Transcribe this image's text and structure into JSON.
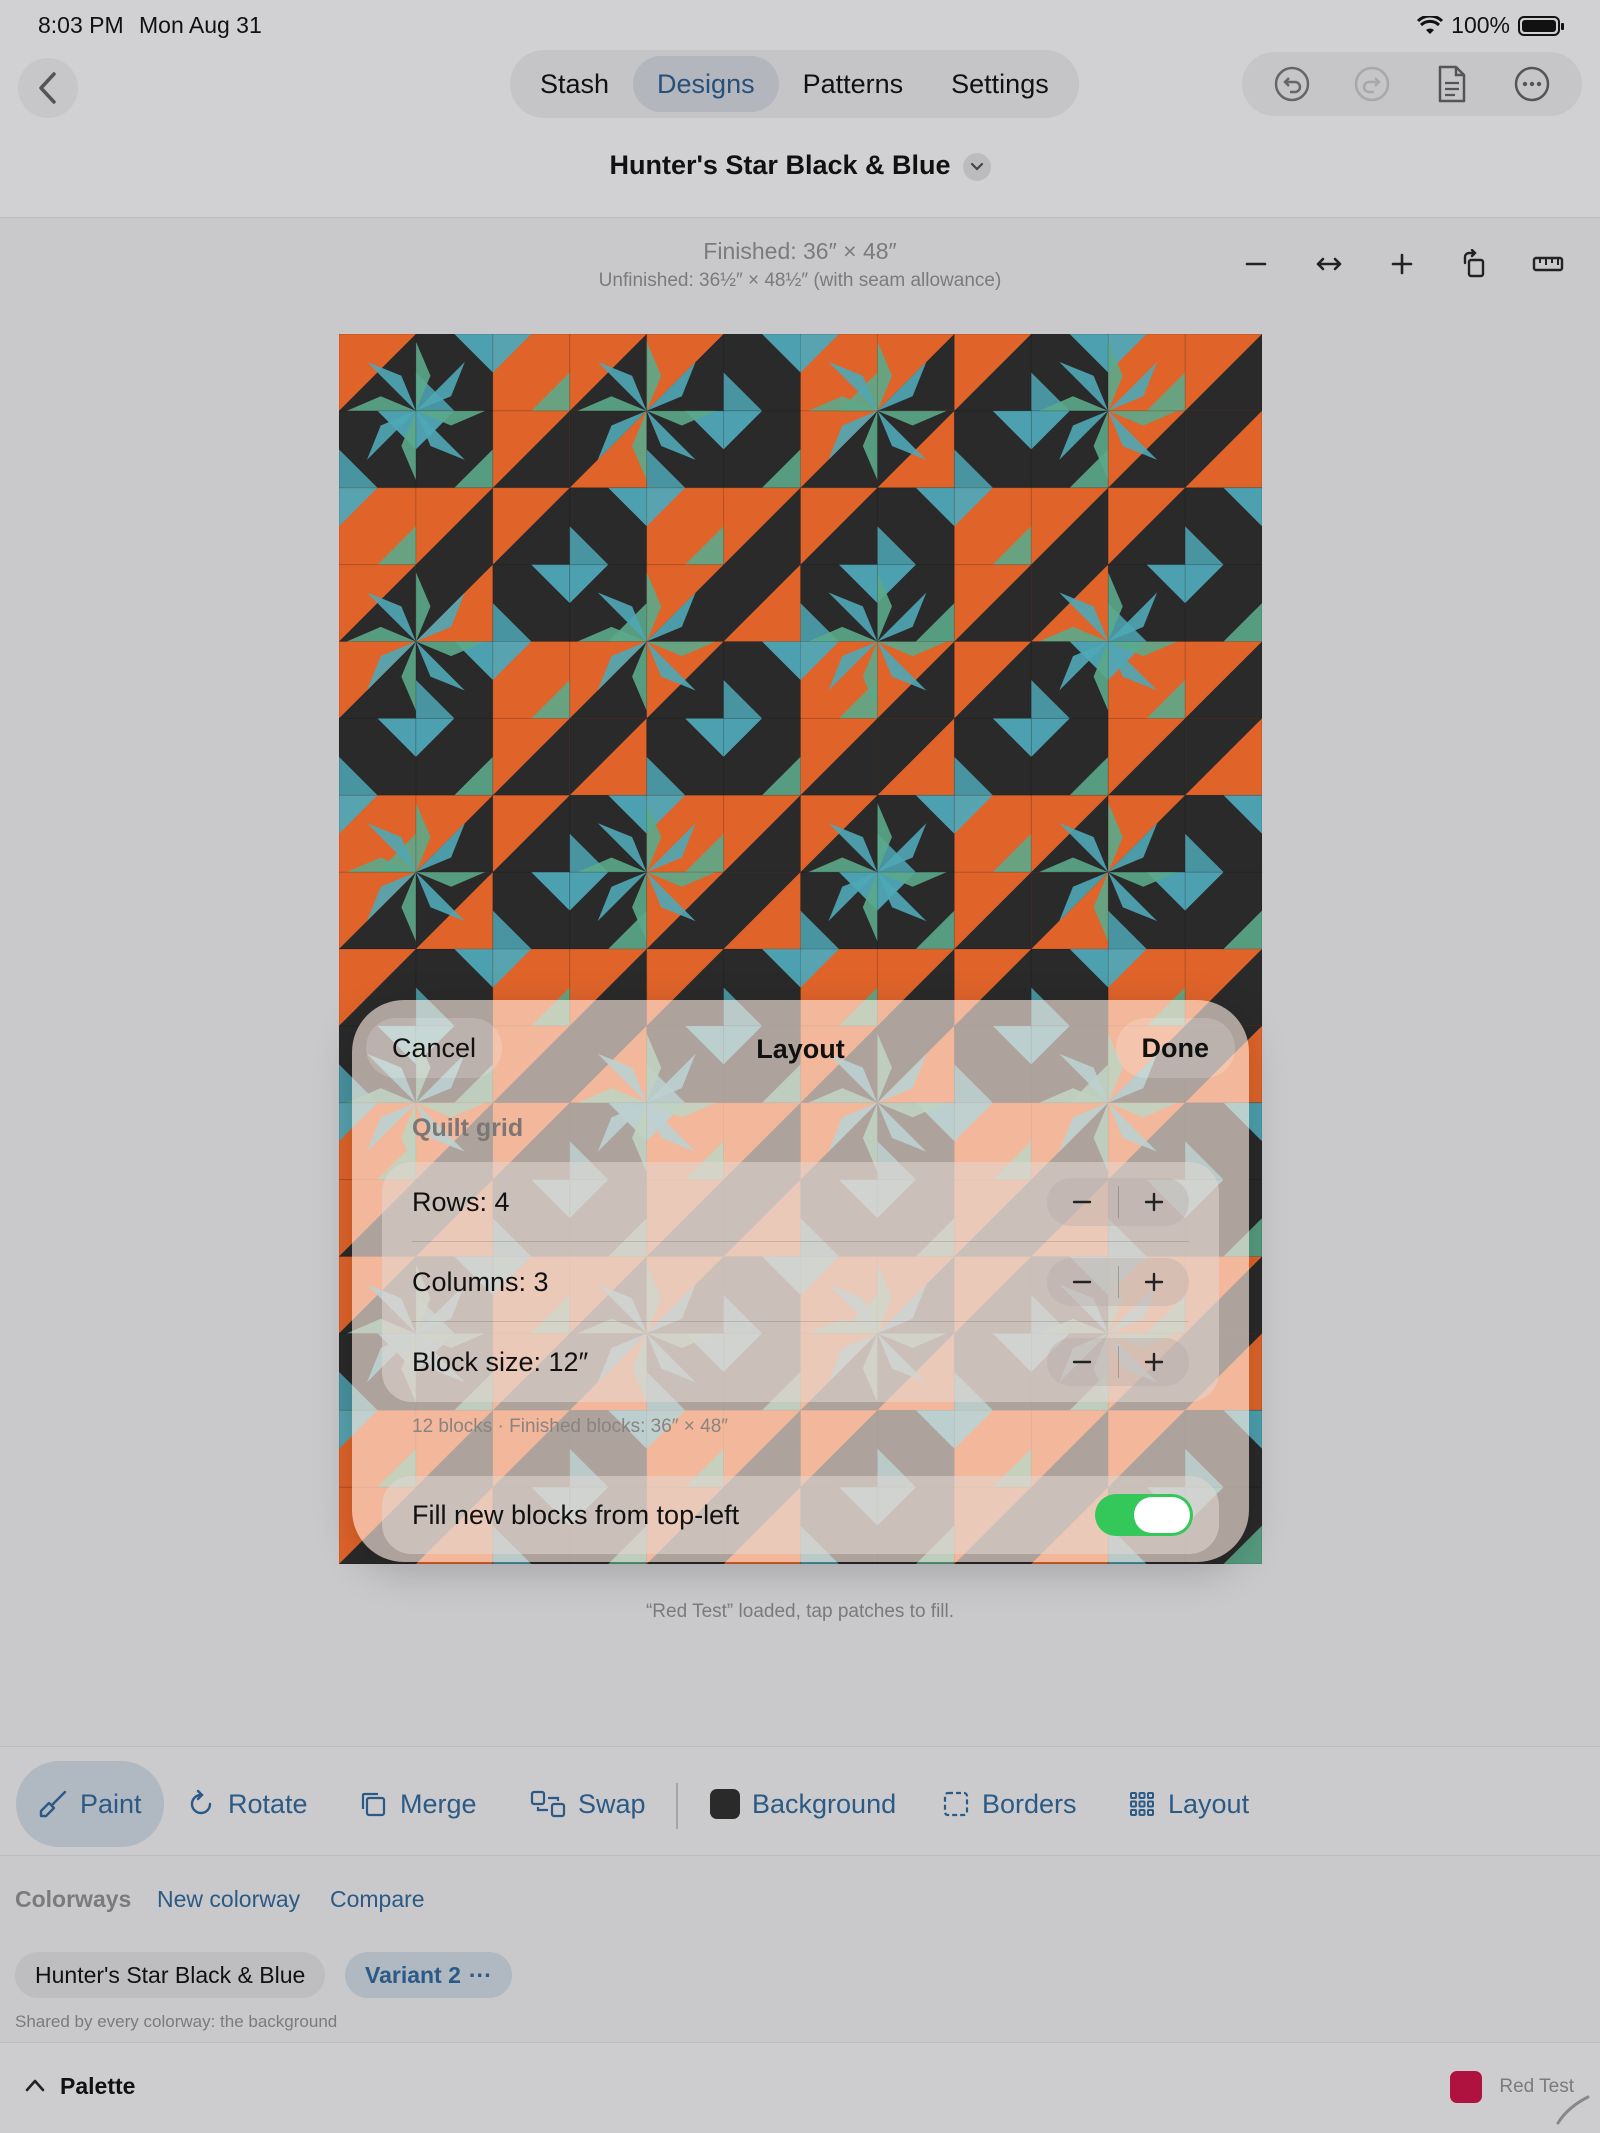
{
  "status": {
    "time": "8:03 PM",
    "date": "Mon Aug 31",
    "battery": "100%"
  },
  "nav": {
    "tabs": [
      {
        "label": "Stash"
      },
      {
        "label": "Designs",
        "active": true
      },
      {
        "label": "Patterns"
      },
      {
        "label": "Settings"
      }
    ],
    "design_title": "Hunter's Star Black & Blue"
  },
  "canvas": {
    "finished": "Finished: 36″ × 48″",
    "unfinished": "Unfinished: 36½″ × 48½″ (with seam allowance)",
    "hint": "“Red Test” loaded, tap patches to fill.",
    "quilt_colors": {
      "orange": "#e0642a",
      "black": "#2a2a2b",
      "teal": "#4fa7b6",
      "green": "#5ba88a"
    }
  },
  "sheet": {
    "cancel": "Cancel",
    "title": "Layout",
    "done": "Done",
    "section": "Quilt grid",
    "rows": [
      {
        "label": "Rows: 4"
      },
      {
        "label": "Columns: 3"
      },
      {
        "label": "Block size: 12″"
      }
    ],
    "summary": "12 blocks  ·  Finished blocks: 36″ × 48″",
    "toggle_label": "Fill new blocks from top-left",
    "toggle_on": true
  },
  "toolbar": {
    "paint": "Paint",
    "rotate": "Rotate",
    "merge": "Merge",
    "swap": "Swap",
    "background": "Background",
    "borders": "Borders",
    "layout": "Layout"
  },
  "colorways": {
    "label": "Colorways",
    "new": "New colorway",
    "compare": "Compare",
    "chips": [
      "Hunter's Star Black & Blue",
      "Variant 2"
    ],
    "note": "Shared by every colorway: the background"
  },
  "palette": {
    "label": "Palette",
    "swatch_name": "Red Test",
    "swatch_color": "#b0123f"
  }
}
